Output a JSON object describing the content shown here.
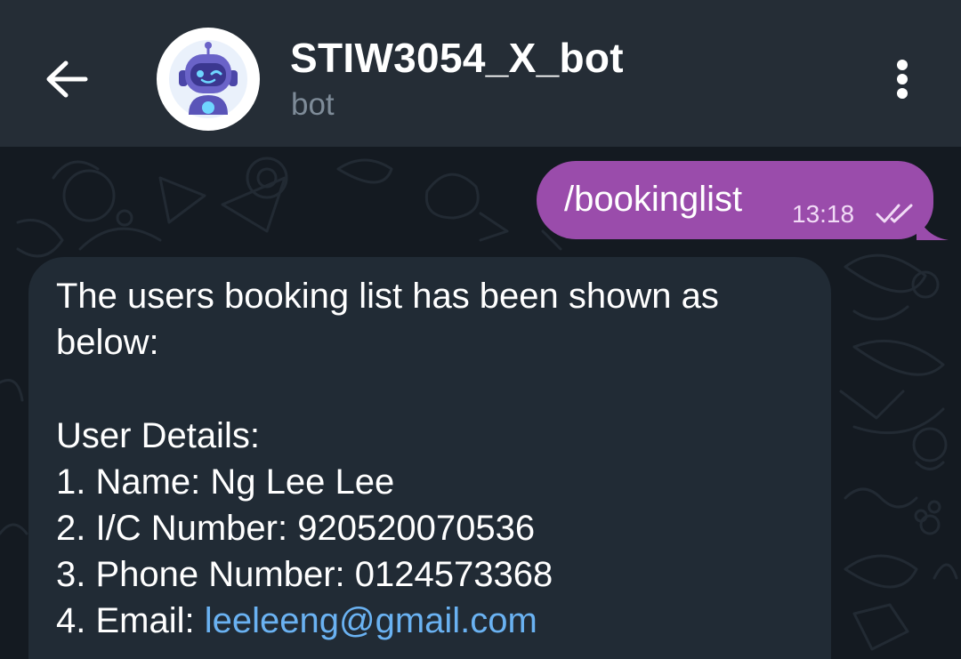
{
  "header": {
    "back_icon": "arrow-left-icon",
    "avatar_icon": "robot-avatar-icon",
    "title": "STIW3054_X_bot",
    "subtitle": "bot",
    "menu_icon": "more-vertical-icon"
  },
  "messages": {
    "outgoing": {
      "text": "/bookinglist",
      "time": "13:18",
      "status_icon": "double-check-icon"
    },
    "incoming": {
      "line1": "The users booking list has been shown as",
      "line2": "below:",
      "details_heading": "User Details:",
      "name_label": "1. Name: ",
      "name_value": "Ng Lee Lee",
      "ic_label": "2. I/C Number: ",
      "ic_value": "920520070536",
      "phone_label": "3. Phone Number: ",
      "phone_value": "0124573368",
      "email_label": "4. Email: ",
      "email_value": "leeleeng@gmail.com"
    }
  },
  "colors": {
    "header_bg": "#252d36",
    "chat_bg": "#141a21",
    "outgoing_bubble": "#9a4cab",
    "incoming_bubble": "#212b35",
    "link": "#6ab2f2",
    "muted_text": "#7e8b98"
  }
}
